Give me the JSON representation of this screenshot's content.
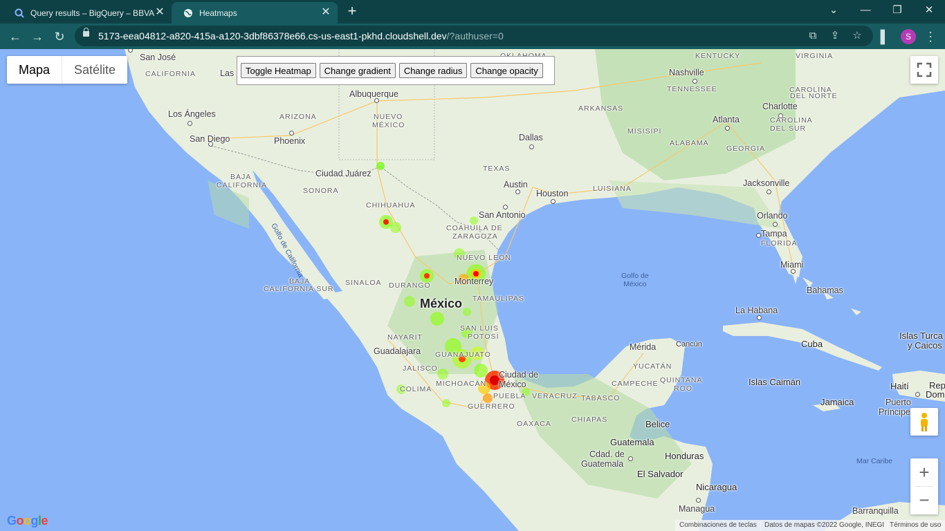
{
  "browser": {
    "tabs": [
      {
        "title": "Query results – BigQuery – BBVA",
        "active": false,
        "icon": "bigquery-icon"
      },
      {
        "title": "Heatmaps",
        "active": true,
        "icon": "globe-icon"
      }
    ],
    "url_host": "5173-eea04812-a820-415a-a120-3dbf86378e66.cs-us-east1-pkhd.cloudshell.dev",
    "url_path": "/?authuser=0",
    "profile_initial": "S"
  },
  "map": {
    "map_type": {
      "map": "Mapa",
      "satellite": "Satélite"
    },
    "buttons": {
      "toggle": "Toggle Heatmap",
      "gradient": "Change gradient",
      "radius": "Change radius",
      "opacity": "Change opacity"
    },
    "labels": {
      "san_jose": "San José",
      "las": "Las",
      "albuquerque": "Albuquerque",
      "los_angeles": "Los Ángeles",
      "san_diego": "San Diego",
      "phoenix": "Phoenix",
      "ciudad_juarez": "Ciudad Juárez",
      "dallas": "Dallas",
      "austin": "Austin",
      "houston": "Houston",
      "san_antonio": "San Antonio",
      "nashville": "Nashville",
      "charlotte": "Charlotte",
      "atlanta": "Atlanta",
      "jacksonville": "Jacksonville",
      "orlando": "Orlando",
      "tampa": "Tampa",
      "miami": "Miami",
      "monterrey": "Monterrey",
      "mexico": "México",
      "guadalajara": "Guadalajara",
      "ciudad_de_mexico_1": "Ciudad de",
      "ciudad_de_mexico_2": "México",
      "merida": "Mérida",
      "cancun": "Cancún",
      "la_habana": "La Habana",
      "cuba": "Cuba",
      "bahamas": "Bahamas",
      "islas_caiman": "Islas Caimán",
      "jamaica": "Jamaica",
      "haiti": "Haití",
      "rep_dom": "Rep",
      "rep_dom2": "Dom",
      "puerto": "Puerto",
      "principe": "Príncipe",
      "islas_turcas": "Islas Turca",
      "y_caicos": "y Caicos",
      "belice": "Belice",
      "guatemala": "Guatemala",
      "ciudad_guatemala_1": "Cdad. de",
      "ciudad_guatemala_2": "Guatemala",
      "honduras": "Honduras",
      "el_salvador": "El Salvador",
      "nicaragua": "Nicaragua",
      "managua": "Managua",
      "barranquilla": "Barranquilla"
    },
    "states": {
      "california": "CALIFORNIA",
      "arizona": "ARIZONA",
      "nuevo_mexico_1": "NUEVO",
      "nuevo_mexico_2": "MÉXICO",
      "texas": "TEXAS",
      "oklahoma": "OKLAHOMA",
      "arkansas": "ARKANSAS",
      "misisipi": "MISISIPI",
      "alabama": "ALABAMA",
      "georgia": "GEORGIA",
      "luisiana": "LUISIANA",
      "tennessee": "TENNESSEE",
      "kentucky": "KENTUCKY",
      "virginia": "VIRGINIA",
      "carolina_norte_1": "CAROLINA",
      "carolina_norte_2": "DEL NORTE",
      "carolina_sur_1": "CAROLINA",
      "carolina_sur_2": "DEL SUR",
      "florida": "FLORIDA",
      "baja_california_1": "BAJA",
      "baja_california_2": "CALIFORNIA",
      "sonora": "SONORA",
      "chihuahua": "CHIHUAHUA",
      "coahuila_1": "COAHUILA DE",
      "coahuila_2": "ZARAGOZA",
      "nuevo_leon": "NUEVO LEÓN",
      "sinaloa": "SINALOA",
      "durango": "DURANGO",
      "tamaulipas": "TAMAULIPAS",
      "bcs_1": "BAJA",
      "bcs_2": "CALIFORNIA SUR",
      "san_luis_1": "SAN LUIS",
      "san_luis_2": "POTOSÍ",
      "nayarit": "NAYARIT",
      "guanajuato": "GUANAJUATO",
      "jalisco": "JALISCO",
      "michoacan": "MICHOACÁN",
      "colima": "COLIMA",
      "puebla": "PUEBLA",
      "veracruz": "VERACRUZ",
      "guerrero": "GUERRERO",
      "oaxaca": "OAXACA",
      "tabasco": "TABASCO",
      "chiapas": "CHIAPAS",
      "campeche": "CAMPECHE",
      "yucatan": "YUCATÁN",
      "quintana_1": "QUINTANA",
      "quintana_2": "ROO"
    },
    "water": {
      "golfo_california": "Golfo de California",
      "golfo_mexico_1": "Golfo de",
      "golfo_mexico_2": "México",
      "mar_caribe": "Mar Caribe"
    },
    "attribution": {
      "shortcuts": "Combinaciones de teclas",
      "data": "Datos de mapas ©2022 Google, INEGI",
      "terms": "Términos de uso"
    },
    "logo": "Google",
    "colors": {
      "land": "#e8efe0",
      "water": "#8ab4f8",
      "heat_low": "#66ff00",
      "heat_high": "#ff0000"
    }
  }
}
